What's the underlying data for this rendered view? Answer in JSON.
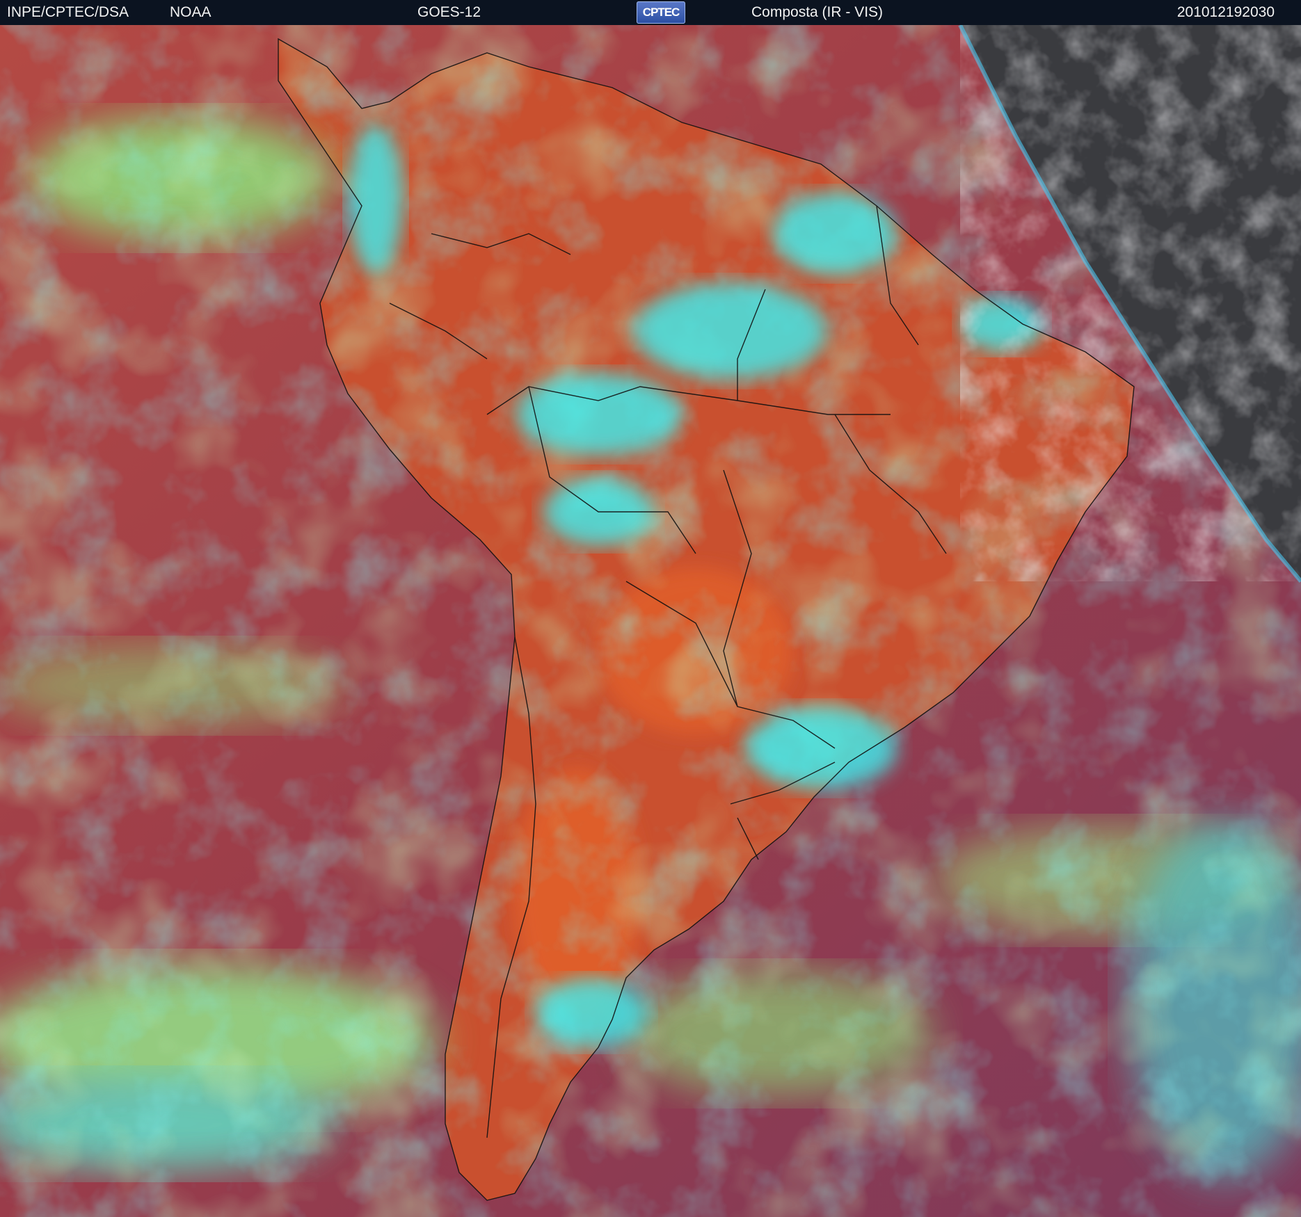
{
  "header": {
    "agency": "INPE/CPTEC/DSA",
    "partner": "NOAA",
    "satellite": "GOES-12",
    "logo_text": "CPTEC",
    "product": "Composta (IR - VIS)",
    "timestamp": "201012192030"
  },
  "colors": {
    "ocean_base": "#8e3a4a",
    "land_warm": "#d4542c",
    "cloud_cyan": "#38e8ee",
    "cloud_green": "#8ee07a",
    "border_lines": "#111111",
    "night_gray": "#3a3b3f"
  },
  "icons": {
    "logo": "cptec-logo"
  }
}
